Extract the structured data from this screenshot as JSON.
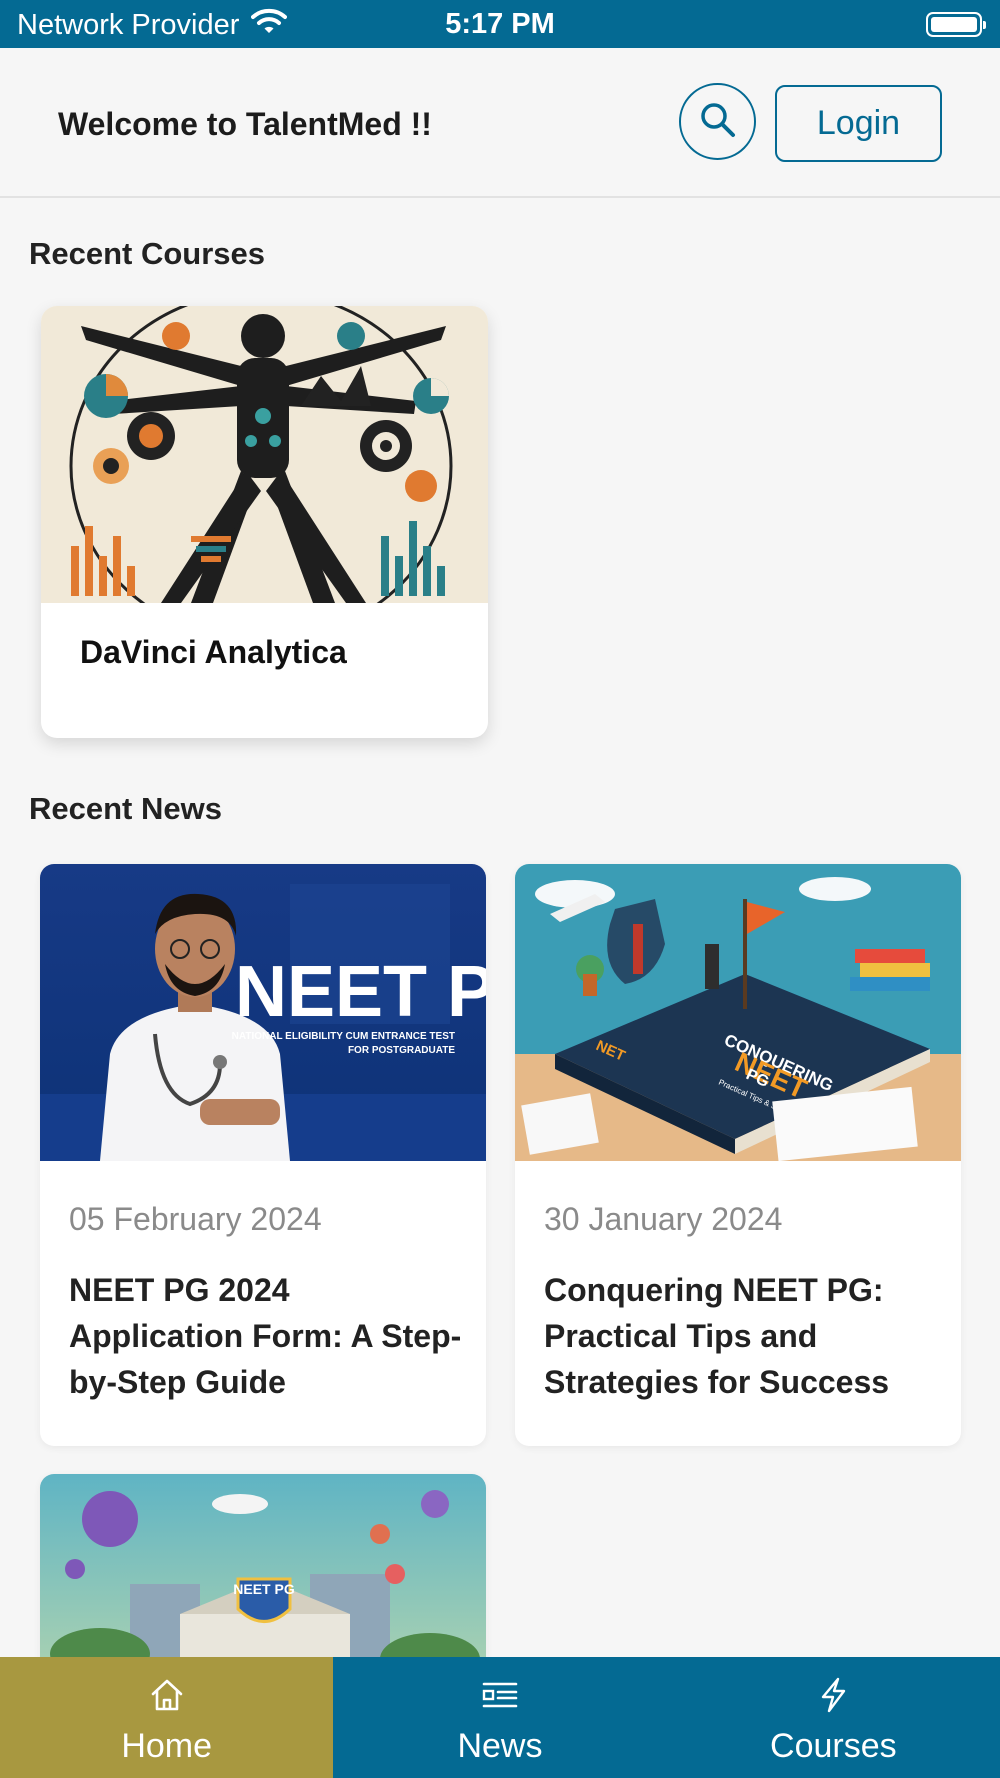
{
  "status_bar": {
    "carrier": "Network Provider",
    "time": "5:17 PM",
    "wifi_icon": "wifi-icon",
    "battery_icon": "battery-icon"
  },
  "header": {
    "welcome": "Welcome to TalentMed !!",
    "search_icon": "search-icon",
    "login_label": "Login"
  },
  "sections": {
    "recent_courses": "Recent Courses",
    "recent_news": "Recent News"
  },
  "courses": [
    {
      "title": "DaVinci Analytica",
      "image": "vitruvian-man-infographic"
    }
  ],
  "news": [
    {
      "date": "05 February 2024",
      "title": "NEET PG 2024 Application Form: A Step-by-Step Guide",
      "image": "doctor-neet-pg-banner",
      "image_text": "NEET PG",
      "image_subtext_1": "NATIONAL ELIGIBILITY CUM ENTRANCE TEST",
      "image_subtext_2": "FOR POSTGRADUATE"
    },
    {
      "date": "30 January 2024",
      "title": "Conquering NEET PG: Practical Tips and Strategies for Success",
      "image": "conquering-neet-book-illustration",
      "image_text_1": "CONQUERING",
      "image_text_2": "NEET",
      "image_text_3": "PG",
      "image_text_4": "Practical Tips & Strategies for Success",
      "image_text_5": "NET"
    },
    {
      "date": "",
      "title": "",
      "image": "neet-pg-shield-building-illustration",
      "image_text": "NEET PG"
    }
  ],
  "bottom_nav": [
    {
      "label": "Home",
      "icon": "home-icon",
      "active": true
    },
    {
      "label": "News",
      "icon": "news-icon",
      "active": false
    },
    {
      "label": "Courses",
      "icon": "lightning-icon",
      "active": false
    }
  ],
  "colors": {
    "primary": "#046a93",
    "active_tab": "#a89840",
    "background": "#f6f6f6"
  }
}
